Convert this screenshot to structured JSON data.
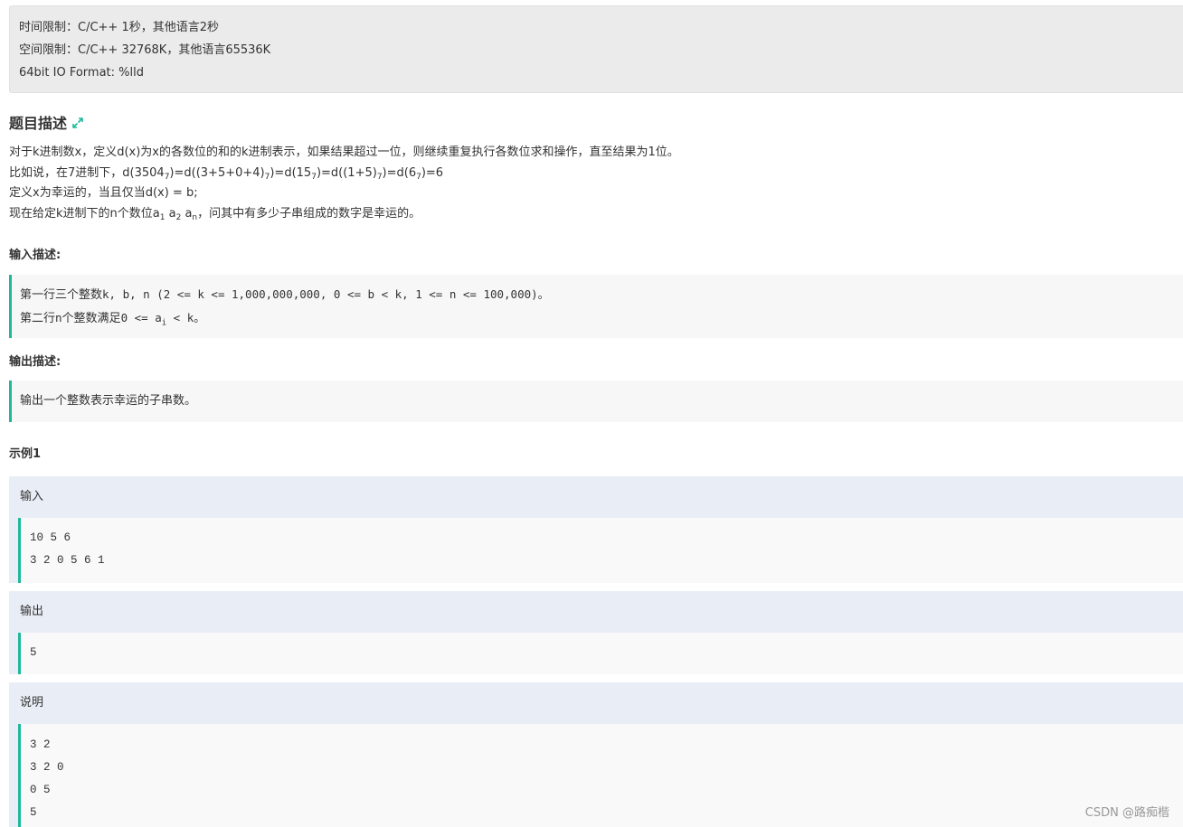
{
  "limits": {
    "time": "时间限制：C/C++ 1秒，其他语言2秒",
    "space": "空间限制：C/C++ 32768K，其他语言65536K",
    "format": "64bit IO Format: %lld"
  },
  "description": {
    "title": "题目描述",
    "line1": "对于k进制数x，定义d(x)为x的各数位的和的k进制表示，如果结果超过一位，则继续重复执行各数位求和操作，直至结果为1位。",
    "line2": {
      "p1": "比如说，在7进制下，d(3504",
      "s1": "7",
      "p2": ")=d((3+5+0+4)",
      "s2": "7",
      "p3": ")=d(15",
      "s3": "7",
      "p4": ")=d((1+5)",
      "s4": "7",
      "p5": ")=d(6",
      "s5": "7",
      "p6": ")=6"
    },
    "line3": "定义x为幸运的，当且仅当d(x) = b;",
    "line4": {
      "p1": "现在给定k进制下的n个数位a",
      "s1": "1",
      "p2": " a",
      "s2": "2",
      "p3": " a",
      "s3": "n",
      "p4": "，问其中有多少子串组成的数字是幸运的。"
    }
  },
  "input_desc": {
    "title": "输入描述:",
    "line1_a": "第一行三个整数",
    "line1_b": "k, b, n (2 <= k <= 1,000,000,000, 0 <= b < k, 1 <= n <= 100,000)。",
    "line2_a": "第二行",
    "line2_b": "n",
    "line2_c": "个整数满足",
    "line2_d": "0 <= a",
    "line2_sub": "i",
    "line2_e": " < k。"
  },
  "output_desc": {
    "title": "输出描述:",
    "text": "输出一个整数表示幸运的子串数。"
  },
  "example": {
    "title": "示例1",
    "input_label": "输入",
    "input_lines": [
      "10 5 6",
      "3 2 0 5 6 1"
    ],
    "output_label": "输出",
    "output_lines": [
      "5"
    ],
    "explain_label": "说明",
    "explain_lines": [
      "3 2",
      "3 2 0",
      "0 5",
      "5"
    ]
  },
  "watermark": "CSDN @路痴楷",
  "colors": {
    "accent": "#1fb89b",
    "limits_bg": "#ebebeb",
    "sample_bg": "#e9eef6"
  }
}
